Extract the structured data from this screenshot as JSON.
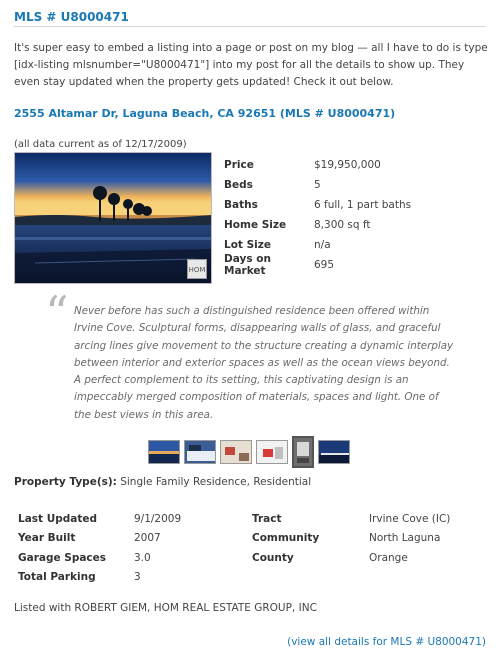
{
  "header": {
    "title": "MLS # U8000471"
  },
  "intro": "It's super easy to embed a listing into a page or post on my blog — all I have to do is type [idx-listing mlsnumber=\"U8000471\"] into my post for all the details to show up. They even stay updated when the property gets updated! Check it out below.",
  "listing": {
    "address_link": "2555 Altamar Dr, Laguna Beach, CA 92651 (MLS # U8000471)",
    "data_current": "(all data current as of 12/17/2009)",
    "photo_badge_icon": "home-logo-icon",
    "stats": [
      {
        "key": "Price",
        "value": "$19,950,000"
      },
      {
        "key": "Beds",
        "value": "5"
      },
      {
        "key": "Baths",
        "value": "6 full, 1 part baths"
      },
      {
        "key": "Home Size",
        "value": "8,300 sq ft"
      },
      {
        "key": "Lot Size",
        "value": "n/a"
      },
      {
        "key": "Days on Market",
        "value": "695"
      }
    ],
    "description": "Never before has such a distinguished residence been offered within Irvine Cove. Sculptural forms, disappearing walls of glass, and graceful arcing lines give movement to the structure creating a dynamic interplay between interior and exterior spaces as well as the ocean views beyond. A perfect complement to its setting, this captivating design is an impeccably merged composition of materials, spaces and light. One of the best views in this area.",
    "quote_glyph": "“",
    "property_type_label": "Property Type(s):",
    "property_type_value": " Single Family Residence, Residential",
    "details": [
      {
        "k1": "Last Updated",
        "v1": "9/1/2009",
        "k2": "Tract",
        "v2": "Irvine Cove (IC)"
      },
      {
        "k1": "Year Built",
        "v1": "2007",
        "k2": "Community",
        "v2": "North Laguna"
      },
      {
        "k1": "Garage Spaces",
        "v1": "3.0",
        "k2": "County",
        "v2": "Orange"
      },
      {
        "k1": "Total Parking",
        "v1": "3",
        "k2": "",
        "v2": ""
      }
    ],
    "listed_with": "Listed with ROBERT GIEM, HOM REAL ESTATE GROUP, INC",
    "view_all_link": "(view all details for MLS # U8000471)"
  }
}
